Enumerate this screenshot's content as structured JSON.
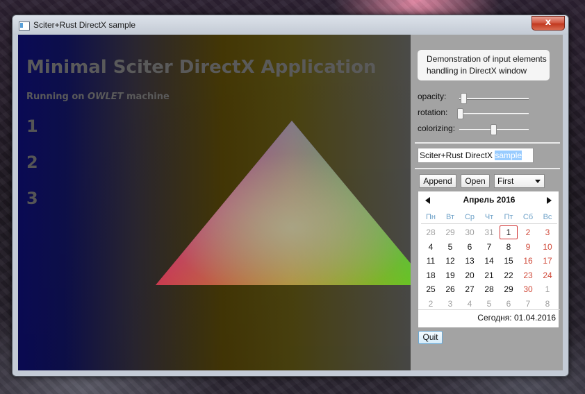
{
  "window": {
    "title": "Sciter+Rust DirectX sample",
    "close_glyph": "x"
  },
  "scene": {
    "heading": "Minimal Sciter DirectX Application",
    "running_prefix": "Running on",
    "machine_name": "OWLET",
    "running_suffix": "machine",
    "numbers": [
      "1",
      "2",
      "3"
    ]
  },
  "panel": {
    "demo_text": "Demonstration of input elements handling in DirectX window",
    "sliders": [
      {
        "label": "opacity:",
        "value": 0.05
      },
      {
        "label": "rotation:",
        "value": 0.0
      },
      {
        "label": "colorizing:",
        "value": 0.5
      }
    ],
    "text_input": {
      "value_plain": "Sciter+Rust DirectX ",
      "value_selected": "sample"
    },
    "buttons": {
      "append": "Append",
      "open": "Open"
    },
    "select": {
      "value": "First"
    },
    "quit": "Quit"
  },
  "calendar": {
    "title": "Апрель  2016",
    "weekdays": [
      "Пн",
      "Вт",
      "Ср",
      "Чт",
      "Пт",
      "Сб",
      "Вс"
    ],
    "weeks": [
      [
        "28",
        "29",
        "30",
        "31",
        "1",
        "2",
        "3"
      ],
      [
        "4",
        "5",
        "6",
        "7",
        "8",
        "9",
        "10"
      ],
      [
        "11",
        "12",
        "13",
        "14",
        "15",
        "16",
        "17"
      ],
      [
        "18",
        "19",
        "20",
        "21",
        "22",
        "23",
        "24"
      ],
      [
        "25",
        "26",
        "27",
        "28",
        "29",
        "30",
        "1"
      ],
      [
        "2",
        "3",
        "4",
        "5",
        "6",
        "7",
        "8"
      ]
    ],
    "today_label": "Сегодня: 01.04.2016"
  },
  "colors": {
    "triangle_top": "#3a2cff",
    "triangle_left": "#ff1a3a",
    "triangle_right": "#2bff1a",
    "panel_bg": "#a3a3a3"
  }
}
